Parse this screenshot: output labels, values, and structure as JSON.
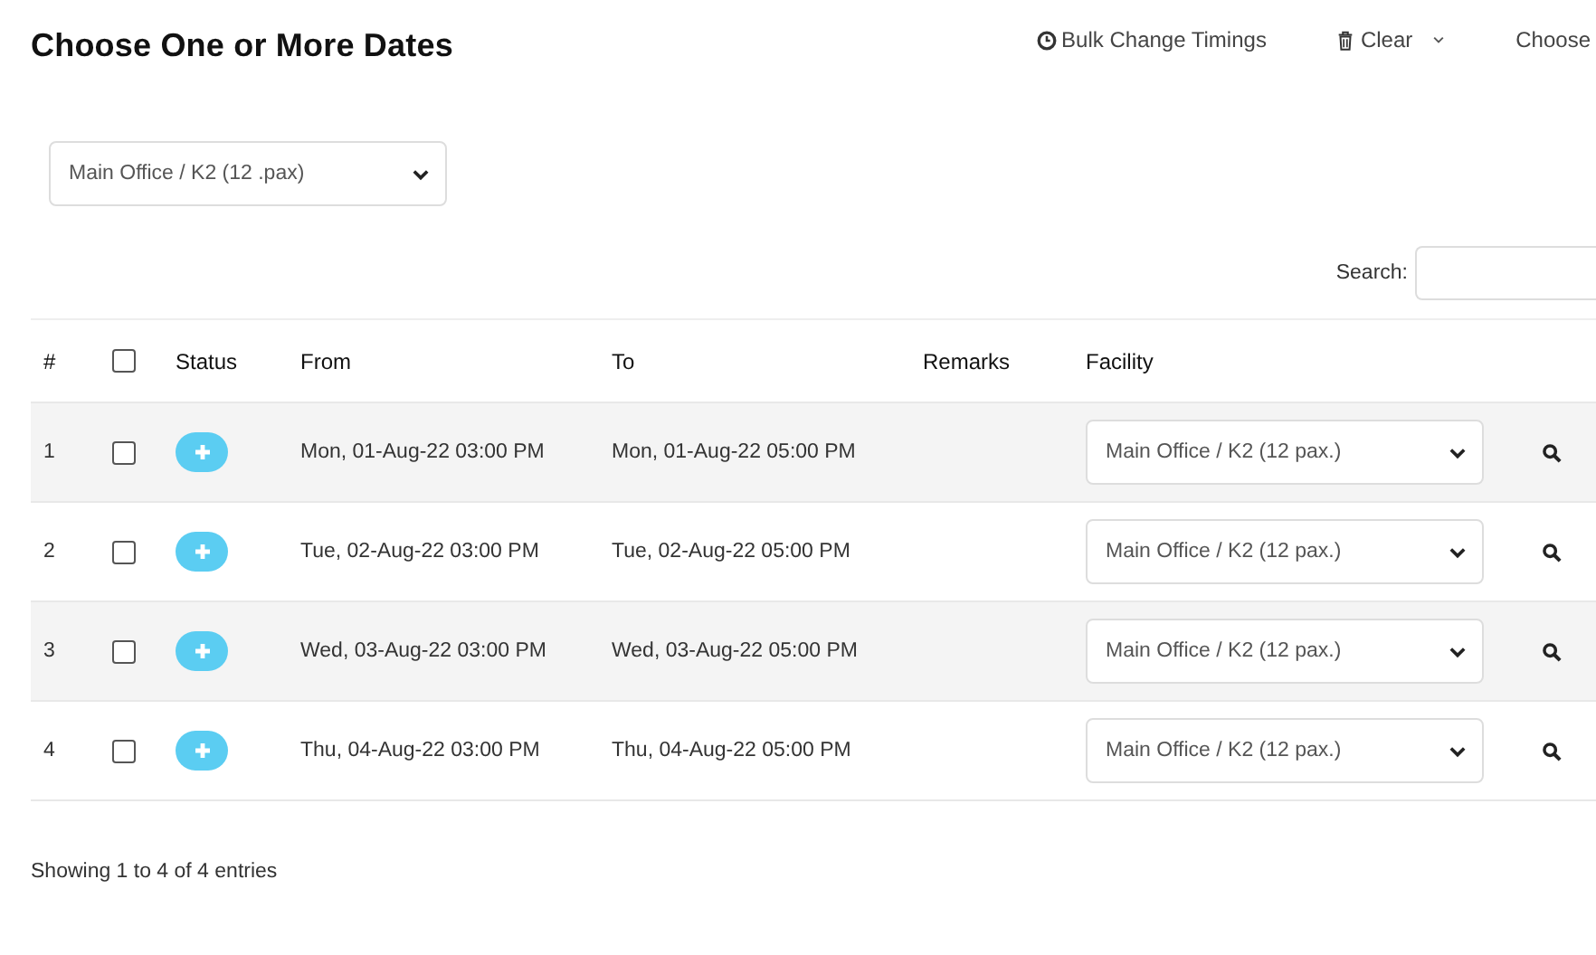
{
  "title": "Choose One or More Dates",
  "actions": [
    {
      "kind": "clock",
      "label": "Bulk Change Timings"
    },
    {
      "kind": "trash-dropdown",
      "label": "Clear"
    },
    {
      "kind": "plain",
      "label": "Choose"
    }
  ],
  "location_select": {
    "value": "Main Office / K2 (12 .pax)"
  },
  "search": {
    "label": "Search:"
  },
  "table": {
    "columns": [
      "#",
      "Status",
      "From",
      "To",
      "Remarks",
      "Facility"
    ],
    "select_all_checked": false,
    "rows": [
      {
        "number": "1",
        "checked": false,
        "from": "Mon, 01-Aug-22 03:00 PM",
        "to": "Mon, 01-Aug-22 05:00 PM",
        "facility": "Main Office / K2 (12 pax.)"
      },
      {
        "number": "2",
        "checked": false,
        "from": "Tue, 02-Aug-22 03:00 PM",
        "to": "Tue, 02-Aug-22 05:00 PM",
        "facility": "Main Office / K2 (12 pax.)"
      },
      {
        "number": "3",
        "checked": false,
        "from": "Wed, 03-Aug-22 03:00 PM",
        "to": "Wed, 03-Aug-22 05:00 PM",
        "facility": "Main Office / K2 (12 pax.)"
      },
      {
        "number": "4",
        "checked": false,
        "from": "Thu, 04-Aug-22 03:00 PM",
        "to": "Thu, 04-Aug-22 05:00 PM",
        "facility": "Main Office / K2 (12 pax.)"
      }
    ]
  },
  "footer": "Showing 1 to 4 of 4 entries"
}
